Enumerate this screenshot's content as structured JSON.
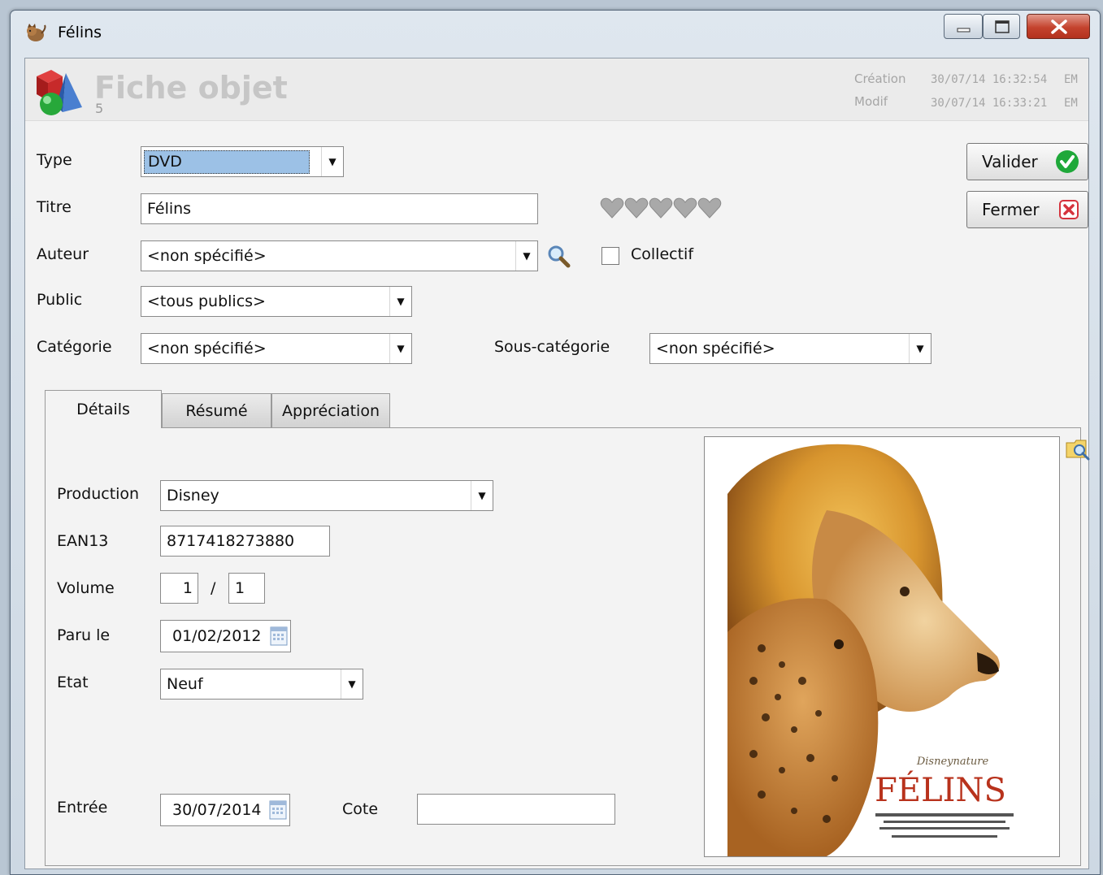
{
  "window": {
    "title": "Félins"
  },
  "header": {
    "title": "Fiche objet",
    "record_id": "5",
    "creation_label": "Création",
    "creation_value": "30/07/14 16:32:54",
    "creation_user": "EM",
    "modif_label": "Modif",
    "modif_value": "30/07/14 16:33:21",
    "modif_user": "EM"
  },
  "form": {
    "type_label": "Type",
    "type_value": "DVD",
    "titre_label": "Titre",
    "titre_value": "Félins",
    "rating_hearts": 5,
    "auteur_label": "Auteur",
    "auteur_value": "<non spécifié>",
    "collectif_label": "Collectif",
    "collectif_checked": false,
    "public_label": "Public",
    "public_value": "<tous publics>",
    "categorie_label": "Catégorie",
    "categorie_value": "<non spécifié>",
    "souscat_label": "Sous-catégorie",
    "souscat_value": "<non spécifié>"
  },
  "buttons": {
    "valider": "Valider",
    "fermer": "Fermer"
  },
  "tabs": [
    {
      "label": "Détails"
    },
    {
      "label": "Résumé"
    },
    {
      "label": "Appréciation"
    }
  ],
  "details": {
    "production_label": "Production",
    "production_value": "Disney",
    "ean_label": "EAN13",
    "ean_value": "8717418273880",
    "volume_label": "Volume",
    "volume_num": "1",
    "volume_sep": "/",
    "volume_total": "1",
    "parule_label": "Paru le",
    "parule_value": "01/02/2012",
    "etat_label": "Etat",
    "etat_value": "Neuf",
    "entree_label": "Entrée",
    "entree_value": "30/07/2014",
    "cote_label": "Cote",
    "cote_value": ""
  },
  "poster": {
    "title": "FÉLINS",
    "studio": "Disneynature"
  },
  "icons": [
    "app-cat-icon",
    "minimize-icon",
    "maximize-icon",
    "close-icon",
    "object-logo-icon",
    "search-icon",
    "check-icon",
    "cancel-icon",
    "calendar-icon",
    "image-preview-icon",
    "heart-icon"
  ]
}
